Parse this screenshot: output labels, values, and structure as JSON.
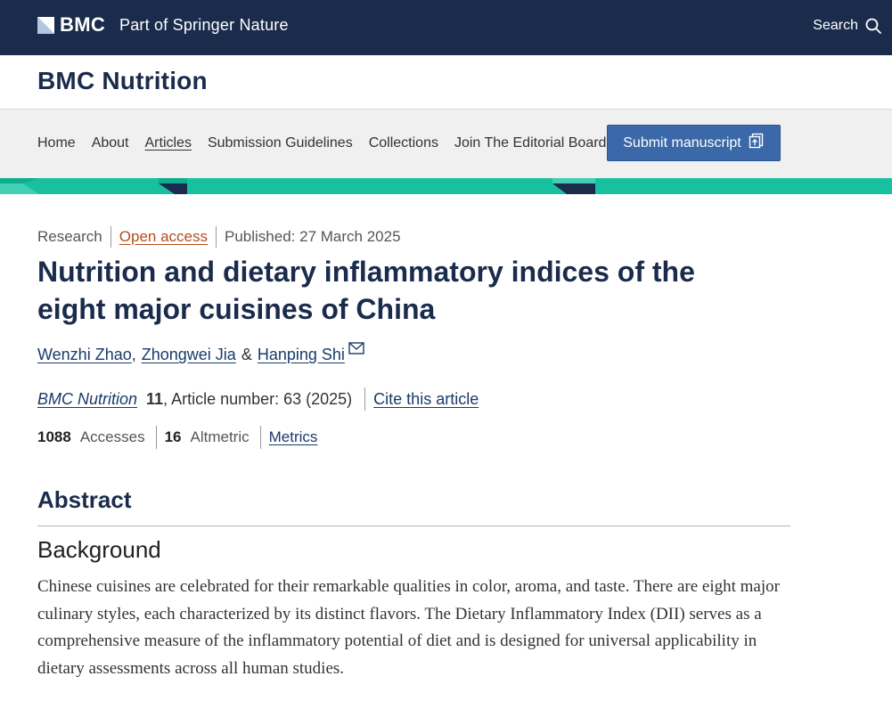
{
  "header": {
    "brand": "BMC",
    "tagline": "Part of Springer Nature",
    "search_label": "Search"
  },
  "journal": {
    "title": "BMC Nutrition"
  },
  "nav": {
    "items": [
      {
        "label": "Home"
      },
      {
        "label": "About"
      },
      {
        "label": "Articles"
      },
      {
        "label": "Submission Guidelines"
      },
      {
        "label": "Collections"
      },
      {
        "label": "Join The Editorial Board"
      }
    ],
    "submit_label": "Submit manuscript"
  },
  "article": {
    "type": "Research",
    "access": "Open access",
    "published": "Published: 27 March 2025",
    "title": "Nutrition and dietary inflammatory indices of the eight major cuisines of China",
    "authors": [
      "Wenzhi Zhao",
      "Zhongwei Jia",
      "Hanping Shi"
    ],
    "author_sep_1": ",",
    "author_sep_2": "&",
    "journal_name": "BMC Nutrition",
    "volume": "11",
    "article_number": ", Article number: 63 (2025)",
    "cite_label": "Cite this article",
    "accesses_count": "1088",
    "accesses_label": "Accesses",
    "altmetric_count": "16",
    "altmetric_label": "Altmetric",
    "metrics_label": "Metrics"
  },
  "abstract": {
    "heading": "Abstract",
    "section_heading": "Background",
    "text": "Chinese cuisines are celebrated for their remarkable qualities in color, aroma, and taste. There are eight major culinary styles, each characterized by its distinct flavors. The Dietary Inflammatory Index (DII) serves as a comprehensive measure of the inflammatory potential of diet and is designed for universal applicability in dietary assessments across all human studies."
  },
  "colors": {
    "header_bg": "#1a2b4c",
    "accent_teal": "#18c0a0",
    "button_blue": "#3a68a8",
    "open_access": "#b24e1e"
  }
}
